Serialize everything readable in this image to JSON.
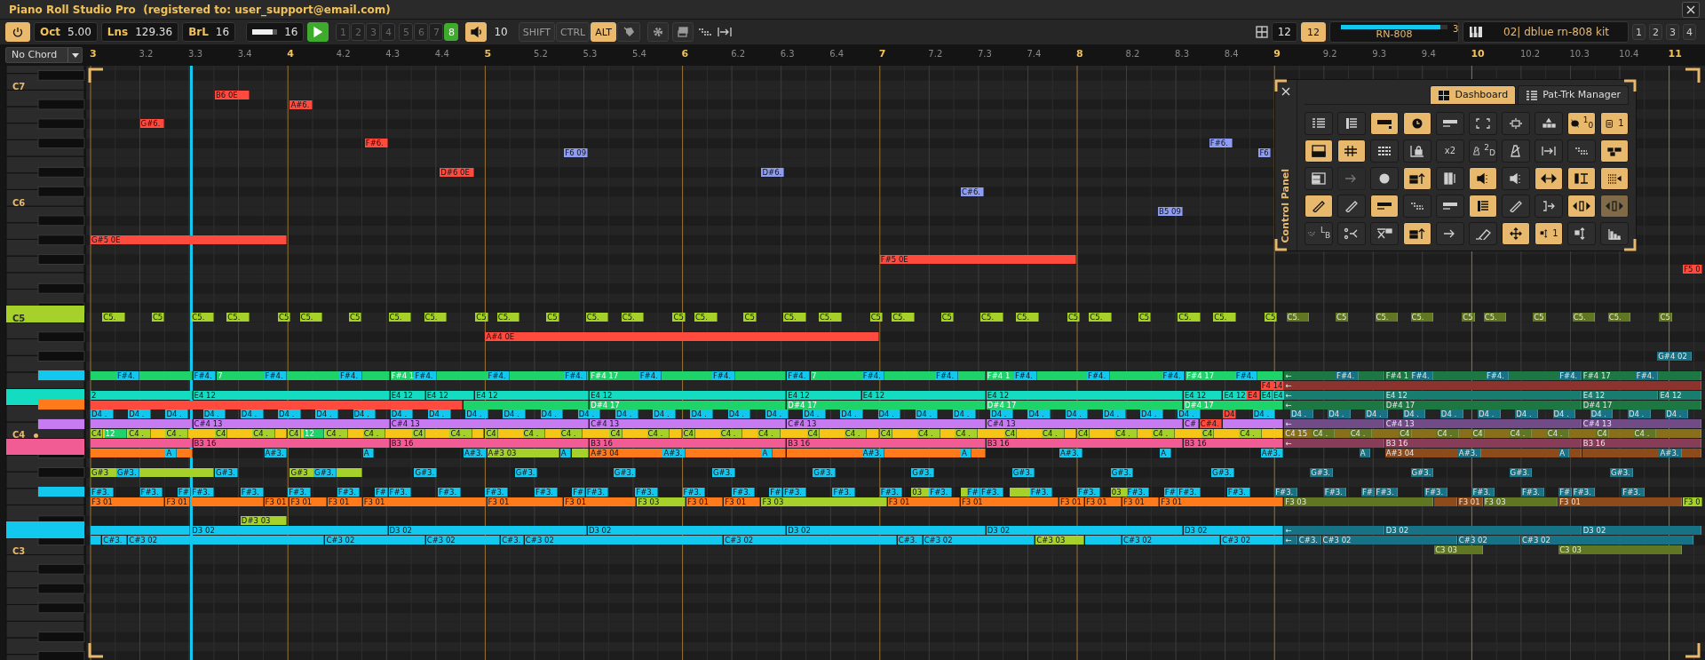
{
  "window": {
    "title": "Piano Roll Studio Pro  (registered to: user_support@email.com)"
  },
  "toolbar": {
    "power": {
      "on": true
    },
    "fields": [
      {
        "label": "Oct",
        "value": "5.00"
      },
      {
        "label": "Lns",
        "value": "129.36"
      },
      {
        "label": "BrL",
        "value": "16"
      }
    ],
    "zoom": {
      "value": "16",
      "level": 0.8
    },
    "slots": [
      {
        "label": "1",
        "selected": false
      },
      {
        "label": "2",
        "selected": false
      },
      {
        "label": "3",
        "selected": false
      },
      {
        "label": "4",
        "selected": false
      },
      {
        "label": "5",
        "selected": false
      },
      {
        "label": "6",
        "selected": false
      },
      {
        "label": "7",
        "selected": false
      },
      {
        "label": "8",
        "selected": true
      }
    ],
    "volume": {
      "on": true,
      "value": "10"
    },
    "modifiers": [
      {
        "label": "SHIFT",
        "selected": false
      },
      {
        "label": "CTRL",
        "selected": false
      },
      {
        "label": "ALT",
        "selected": true
      }
    ],
    "grid": "12",
    "snap": {
      "on": true,
      "value": "12"
    },
    "track": {
      "level": 0.93,
      "number": "3",
      "name": "RN-808"
    },
    "kit": "02| dblue rn-808 kit",
    "pages": [
      "1",
      "2",
      "3",
      "4"
    ]
  },
  "chord": "No Chord",
  "ruler": {
    "labels": [
      "3",
      "3.2",
      "3.3",
      "3.4",
      "4",
      "4.2",
      "4.3",
      "4.4",
      "5",
      "5.2",
      "5.3",
      "5.4",
      "6",
      "6.2",
      "6.3",
      "6.4",
      "7",
      "7.2",
      "7.3",
      "7.4",
      "8",
      "8.2",
      "8.3",
      "8.4",
      "9",
      "9.2",
      "9.3",
      "9.4",
      "10",
      "10.2",
      "10.3",
      "10.4",
      "11"
    ]
  },
  "keyboard": {
    "labels": [
      {
        "text": "C7",
        "dot": false
      },
      {
        "text": "C6",
        "dot": false
      },
      {
        "text": "C5",
        "dot": false
      },
      {
        "text": "C4",
        "dot": true
      },
      {
        "text": "C3",
        "dot": false
      }
    ],
    "active_keys": [
      {
        "color": "#a6d12a"
      },
      {
        "color": "#13c8ef"
      },
      {
        "color": "#14dcc0"
      },
      {
        "color": "#ff7a1a"
      },
      {
        "color": "#c77bf0"
      },
      {
        "color": "#f25c95"
      },
      {
        "color": "#13c8ef"
      },
      {
        "color": "#13c8ef"
      }
    ]
  },
  "roll": {
    "lanes": [
      {
        "color": "#ff4b3e",
        "dimmed": false,
        "notes": [
          "B6 0E"
        ]
      },
      {
        "color": "#ff4b3e",
        "dimmed": false,
        "notes": [
          "A#6."
        ]
      },
      {
        "color": "#ff4b3e",
        "dimmed": false,
        "notes": [
          "G#6."
        ]
      },
      {
        "color": "#ff4b3e",
        "dimmed": false,
        "notes": [
          "F#6."
        ]
      },
      {
        "color": "#8e9cf2",
        "dimmed": false,
        "notes": [
          "F#6."
        ]
      },
      {
        "color": "#8e9cf2",
        "dimmed": false,
        "notes": [
          "F6 09",
          "F6"
        ]
      },
      {
        "color": "#ff4b3e",
        "dimmed": false,
        "notes": [
          "D#6 0E"
        ]
      },
      {
        "color": "#8e9cf2",
        "dimmed": false,
        "notes": [
          "D#6."
        ]
      },
      {
        "color": "#8e9cf2",
        "dimmed": false,
        "notes": [
          "C#6."
        ]
      },
      {
        "color": "#8e9cf2",
        "dimmed": false,
        "notes": [
          "B5 09"
        ]
      },
      {
        "color": "#ff4b3e",
        "dimmed": false,
        "notes": [
          "G#5 0E"
        ]
      },
      {
        "color": "#ff4b3e",
        "dimmed": false,
        "notes": [
          "F#5 0E"
        ]
      },
      {
        "color": "#ff4b3e",
        "dimmed": false,
        "notes": [
          "F5 0"
        ]
      },
      {
        "color": "#a6d12a",
        "dimmed": false,
        "notes": [
          "C5.",
          "C5",
          "C5.",
          "C5.",
          "C5",
          "C5.",
          "C5",
          "C5.",
          "C5.",
          "C5",
          "C5.",
          "C5",
          "C5.",
          "C5.",
          "C5",
          "C5.",
          "C5",
          "C5.",
          "C5.",
          "C5",
          "C5.",
          "C5",
          "C5.",
          "C5.",
          "C5",
          "C5.",
          "C5",
          "C5.",
          "C5.",
          "C5"
        ]
      },
      {
        "color": "#617623",
        "dimmed": true,
        "notes": [
          "C5.",
          "C5",
          "C5.",
          "C5.",
          "C5",
          "C5.",
          "C5",
          "C5.",
          "C5.",
          "C5"
        ]
      },
      {
        "color": "#ff4b3e",
        "dimmed": false,
        "notes": [
          "A#4 0E"
        ]
      },
      {
        "color": "#177285",
        "dimmed": true,
        "notes": [
          "G#4 02"
        ]
      },
      {
        "color": "#1fd36b",
        "dimmed": false,
        "light_text": true,
        "notes": [
          "7",
          "F#4 1",
          "F#4 17",
          "7",
          "F#4 1",
          "F#4 17"
        ]
      },
      {
        "color": "#13c8ef",
        "dimmed": false,
        "notes": [
          "F#4.",
          "F#4.",
          "F#4.",
          "F#4.",
          "F#4.",
          "F#4.",
          "F#4.",
          "F#4.",
          "F#4.",
          "F#4.",
          "F#4.",
          "F#4.",
          "F#4.",
          "F#4.",
          "F#4.",
          "F#4."
        ]
      },
      {
        "color": "#1d7743",
        "dimmed": true,
        "light_text": true,
        "notes": [
          "←",
          "F#4 1",
          "F#4 17"
        ]
      },
      {
        "color": "#177285",
        "dimmed": true,
        "notes": [
          "F#4.",
          "F#4.",
          "F#4.",
          "F#4.",
          "F#4."
        ]
      },
      {
        "color": "#ff4b3e",
        "dimmed": false,
        "notes": [
          "F4 14"
        ]
      },
      {
        "color": "#8d332d",
        "dimmed": true,
        "notes": [
          "←"
        ]
      },
      {
        "color": "#14dcc0",
        "dimmed": false,
        "notes": [
          "2",
          "E4 12",
          "E4 12",
          "E4 12",
          "E4 12",
          "E4 12",
          "E4 12",
          "E4 12",
          "E4 12",
          "E4 12",
          "E4 12",
          "E4",
          "E4"
        ]
      },
      {
        "color": "#ff4b3e",
        "dimmed": false,
        "notes": [
          "E4"
        ]
      },
      {
        "color": "#187c6e",
        "dimmed": true,
        "notes": [
          "←",
          "E4 12",
          "E4 12",
          "E4 12"
        ]
      },
      {
        "color": "#ff4b3e",
        "dimmed": false
      },
      {
        "color": "#1fd36b",
        "dimmed": false,
        "light_text": true,
        "notes": [
          "D#4 17",
          "D#4 17",
          "D#4 17",
          "D#4 17"
        ]
      },
      {
        "color": "#1d7743",
        "dimmed": true,
        "light_text": true,
        "notes": [
          "←",
          "D#4 17",
          "D#4 17"
        ]
      },
      {
        "color": "#13c8ef",
        "dimmed": false,
        "notes": [
          "D4 .",
          "D4 .",
          "D4 .",
          "D4 .",
          "D4 .",
          "D4 .",
          "D4 .",
          "D4 .",
          "D4 .",
          "D4 .",
          "D4 .",
          "D4 .",
          "D4 .",
          "D4 .",
          "D4 .",
          "D4 .",
          "D4 .",
          "D4 .",
          "D4 .",
          "D4 .",
          "D4 .",
          "D4 .",
          "D4 .",
          "D4 .",
          "D4 .",
          "D4 .",
          "D4 .",
          "D4 .",
          "D4 .",
          "D4 .",
          "D4 ."
        ]
      },
      {
        "color": "#ff4b3e",
        "dimmed": false,
        "notes": [
          "D4"
        ]
      },
      {
        "color": "#177285",
        "dimmed": true,
        "notes": [
          "D4 .",
          "D4 .",
          "D4 .",
          "D4 .",
          "D4 .",
          "D4 .",
          "D4 .",
          "D4 .",
          "D4 .",
          "D4 .",
          "D4 ."
        ]
      },
      {
        "color": "#c77bf0",
        "dimmed": false,
        "notes": [
          "C#4 13",
          "C#4 13",
          "C#4 13",
          "C#4 13",
          "C#4 13",
          "C#"
        ]
      },
      {
        "color": "#ff4b3e",
        "dimmed": false,
        "notes": [
          "C#4."
        ]
      },
      {
        "color": "#714b86",
        "dimmed": true,
        "notes": [
          "←",
          "C#4 13",
          "C#4 13"
        ]
      },
      {
        "color": "#f5c518",
        "dimmed": false
      },
      {
        "color": "#a6d12a",
        "dimmed": false,
        "notes": [
          "C4",
          "C4 .",
          "C4 .",
          "C4",
          "C4 .",
          "C4",
          "C4 .",
          "C4 .",
          "C4",
          "C4 .",
          "C4",
          "C4 .",
          "C4 .",
          "C4",
          "C4 .",
          "C4",
          "C4 .",
          "C4 .",
          "C4",
          "C4 .",
          "C4",
          "C4 .",
          "C4 .",
          "C4",
          "C4 .",
          "C4",
          "C4 .",
          "C4 .",
          "C4",
          "C4 ."
        ]
      },
      {
        "color": "#1fd36b",
        "dimmed": false,
        "light_text": true,
        "notes": [
          "12",
          "12"
        ]
      },
      {
        "color": "#88701a",
        "dimmed": true,
        "notes": [
          "C4 15"
        ]
      },
      {
        "color": "#617623",
        "dimmed": true,
        "notes": [
          "C4 .",
          "C4 .",
          "C4",
          "C4 .",
          "C4",
          "C4 .",
          "C4 .",
          "C4",
          "C4 ."
        ]
      },
      {
        "color": "#f25c95",
        "dimmed": false,
        "notes": [
          "B3 16",
          "B3 16",
          "B3 16",
          "B3 16",
          "B3 16",
          "B3 16"
        ]
      },
      {
        "color": "#873c58",
        "dimmed": true,
        "notes": [
          "←",
          "B3 16",
          "B3 16"
        ]
      },
      {
        "color": "#ff7a1a",
        "dimmed": false,
        "notes": [
          "A#3 04"
        ]
      },
      {
        "color": "#13c8ef",
        "dimmed": false,
        "notes": [
          "A",
          "A#3.",
          "A",
          "A#3.",
          "A",
          "A#3.",
          "A",
          "A#3.",
          "A",
          "A#3.",
          "A",
          "A#3."
        ]
      },
      {
        "color": "#a6d12a",
        "dimmed": false,
        "notes": [
          "A#3 03"
        ]
      },
      {
        "color": "#177285",
        "dimmed": true,
        "notes": [
          "A",
          "A#3.",
          "A",
          "A#3."
        ]
      },
      {
        "color": "#8d4b1b",
        "dimmed": true,
        "notes": [
          "A#3 04"
        ]
      },
      {
        "color": "#a6d12a",
        "dimmed": false,
        "notes": [
          "G#3",
          "G#3"
        ]
      },
      {
        "color": "#13c8ef",
        "dimmed": false,
        "notes": [
          "G#3.",
          "G#3.",
          "G#3.",
          "G#3.",
          "G#3.",
          "G#3.",
          "G#3.",
          "G#3.",
          "G#3.",
          "G#3.",
          "G#3.",
          "G#3."
        ]
      },
      {
        "color": "#177285",
        "dimmed": true,
        "notes": [
          "G#3.",
          "G#3.",
          "G#3.",
          "G#3."
        ]
      },
      {
        "color": "#13c8ef",
        "dimmed": false,
        "notes": [
          "F#3.",
          "F#3.",
          "F#",
          "F#3.",
          "F#3.",
          "F#3.",
          "F#3.",
          "F#",
          "F#3.",
          "F#3.",
          "F#3.",
          "F#3.",
          "F#",
          "F#3.",
          "F#3.",
          "F#3.",
          "F#3.",
          "F#",
          "F#3.",
          "F#3.",
          "F#3.",
          "F#3.",
          "F#",
          "F#3.",
          "F#3.",
          "F#3.",
          "F#3.",
          "F#",
          "F#3.",
          "F#3."
        ]
      },
      {
        "color": "#a6d12a",
        "dimmed": false,
        "notes": [
          "03",
          "03"
        ]
      },
      {
        "color": "#177285",
        "dimmed": true,
        "notes": [
          "F#3.",
          "F#3.",
          "F#",
          "F#3.",
          "F#3.",
          "F#3.",
          "F#3.",
          "F#",
          "F#3.",
          "F#3."
        ]
      },
      {
        "color": "#ff7a1a",
        "dimmed": false,
        "notes": [
          "F3 01",
          "F3 01",
          "F3 01",
          "F3 01",
          "F3 01",
          "F3 01",
          "F3 01",
          "F3 01",
          "F3 01",
          "F3 01",
          "F3 01",
          "F3 01",
          "F3 01",
          "F3 01",
          "F3 01",
          "F3 01"
        ]
      },
      {
        "color": "#a6d12a",
        "dimmed": false,
        "notes": [
          "F3 03",
          "F3 03",
          "F3 0"
        ]
      },
      {
        "color": "#617623",
        "dimmed": true,
        "notes": [
          "F3 03",
          "F3 03"
        ]
      },
      {
        "color": "#8d4b1b",
        "dimmed": true,
        "notes": [
          "F3 01",
          "F3 01"
        ]
      },
      {
        "color": "#a6d12a",
        "dimmed": false,
        "notes": [
          "D#3 03"
        ]
      },
      {
        "color": "#13c8ef",
        "dimmed": false,
        "notes": [
          "D3 02",
          "D3 02",
          "D3 02",
          "D3 02",
          "D3 02",
          "D3 02"
        ]
      },
      {
        "color": "#177285",
        "dimmed": true,
        "notes": [
          "←",
          "D3 02",
          "D3 02"
        ]
      },
      {
        "color": "#13c8ef",
        "dimmed": false,
        "notes": [
          "C#3.",
          "C#3 02",
          "C#3 02",
          "C#3 02",
          "C#3.",
          "C#3 02",
          "C#3 02",
          "C#3.",
          "C#3 02",
          "C#3 02",
          "C#3 02"
        ]
      },
      {
        "color": "#a6d12a",
        "dimmed": false,
        "notes": [
          "C#3 03"
        ]
      },
      {
        "color": "#177285",
        "dimmed": true,
        "notes": [
          "←",
          "C#3.",
          "C#3 02",
          "C#3 02",
          "C#3 02"
        ]
      },
      {
        "color": "#617623",
        "dimmed": true,
        "notes": [
          "C3 03",
          "C3 03"
        ]
      }
    ]
  },
  "control_panel": {
    "title": "Control Panel",
    "tabs": [
      {
        "label": "Dashboard",
        "selected": true
      },
      {
        "label": "Pat-Trk Manager",
        "selected": false
      }
    ],
    "tools": [
      {
        "on": false,
        "disabled": false
      },
      {
        "on": false,
        "disabled": false
      },
      {
        "on": true,
        "disabled": false
      },
      {
        "on": true,
        "disabled": false
      },
      {
        "on": false,
        "disabled": false
      },
      {
        "on": false,
        "disabled": false
      },
      {
        "on": false,
        "disabled": false
      },
      {
        "on": false,
        "disabled": false
      },
      {
        "on": true,
        "disabled": false,
        "text": "$^{1}$$_{0}$"
      },
      {
        "on": true,
        "disabled": false,
        "text": "1"
      },
      {
        "on": true,
        "disabled": false
      },
      {
        "on": true,
        "disabled": false
      },
      {
        "on": false,
        "disabled": false
      },
      {
        "on": false,
        "disabled": false
      },
      {
        "on": false,
        "disabled": false,
        "text": "x2"
      },
      {
        "on": false,
        "disabled": false,
        "text": "$^{2}$$_{D}$"
      },
      {
        "on": false,
        "disabled": false
      },
      {
        "on": false,
        "disabled": false
      },
      {
        "on": false,
        "disabled": false
      },
      {
        "on": true,
        "disabled": false
      },
      {
        "on": false,
        "disabled": false
      },
      {
        "on": false,
        "disabled": true
      },
      {
        "on": false,
        "disabled": false
      },
      {
        "on": true,
        "disabled": false
      },
      {
        "on": false,
        "disabled": false
      },
      {
        "on": true,
        "disabled": false
      },
      {
        "on": false,
        "disabled": false
      },
      {
        "on": true,
        "disabled": false
      },
      {
        "on": true,
        "disabled": false
      },
      {
        "on": true,
        "disabled": false
      },
      {
        "on": true,
        "disabled": false
      },
      {
        "on": false,
        "disabled": false
      },
      {
        "on": true,
        "disabled": false
      },
      {
        "on": false,
        "disabled": false
      },
      {
        "on": false,
        "disabled": false
      },
      {
        "on": true,
        "disabled": false
      },
      {
        "on": false,
        "disabled": false
      },
      {
        "on": false,
        "disabled": false
      },
      {
        "on": true,
        "disabled": false
      },
      {
        "on": true,
        "disabled": true
      },
      {
        "on": false,
        "disabled": false,
        "text": "$^{L}$$_{B}$"
      },
      {
        "on": false,
        "disabled": false
      },
      {
        "on": false,
        "disabled": false
      },
      {
        "on": true,
        "disabled": false
      },
      {
        "on": false,
        "disabled": false
      },
      {
        "on": false,
        "disabled": false
      },
      {
        "on": true,
        "disabled": false
      },
      {
        "on": true,
        "disabled": false,
        "text": "1"
      },
      {
        "on": false,
        "disabled": false
      },
      {
        "on": false,
        "disabled": false
      }
    ]
  }
}
